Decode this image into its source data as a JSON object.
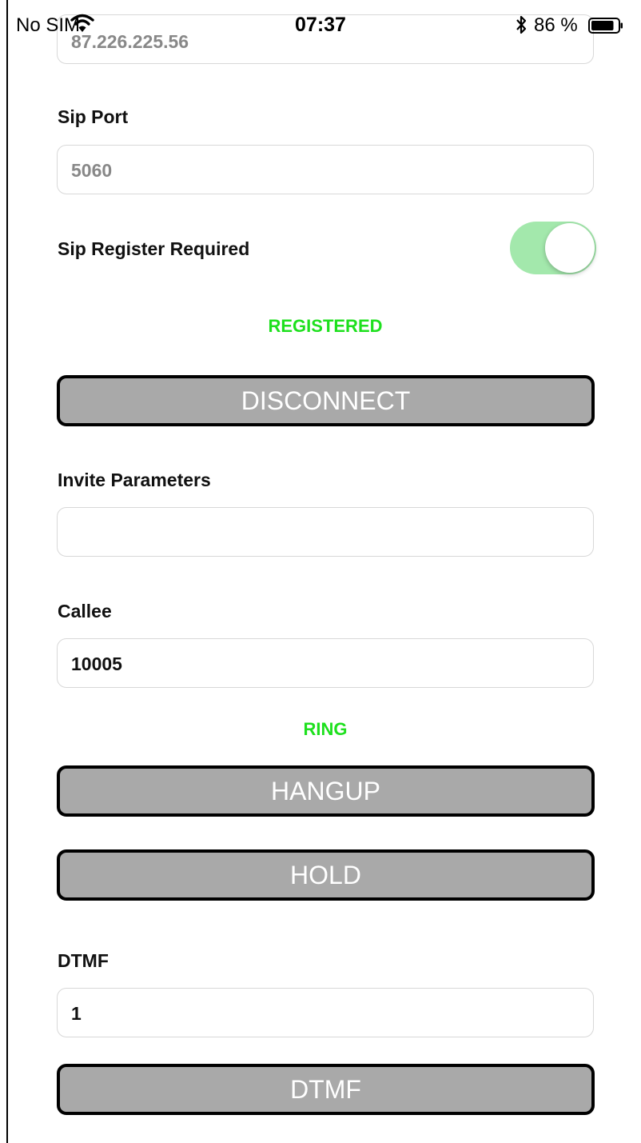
{
  "status_bar": {
    "carrier": "No SIM",
    "time": "07:37",
    "battery_percent": "86 %",
    "wifi_icon": "wifi-icon",
    "bluetooth_icon": "bluetooth-icon",
    "battery_icon": "battery-icon",
    "battery_level": 0.86
  },
  "server_address": {
    "value": "87.226.225.56"
  },
  "sip_port": {
    "label": "Sip Port",
    "placeholder": "5060"
  },
  "register_required": {
    "label": "Sip Register Required",
    "on": true,
    "on_color": "#a3e8ac"
  },
  "registration_status": {
    "text": "REGISTERED",
    "color": "#1ee01e"
  },
  "disconnect_button": {
    "label": "DISCONNECT"
  },
  "invite_parameters": {
    "label": "Invite Parameters",
    "value": ""
  },
  "callee": {
    "label": "Callee",
    "value": "10005"
  },
  "call_status": {
    "text": "RING"
  },
  "hangup_button": {
    "label": "HANGUP"
  },
  "hold_button": {
    "label": "HOLD"
  },
  "dtmf": {
    "label": "DTMF",
    "value": "1",
    "button_label": "DTMF"
  },
  "colors": {
    "button_fill": "#a9a9a9",
    "button_border": "#000000",
    "button_text": "#ffffff"
  }
}
